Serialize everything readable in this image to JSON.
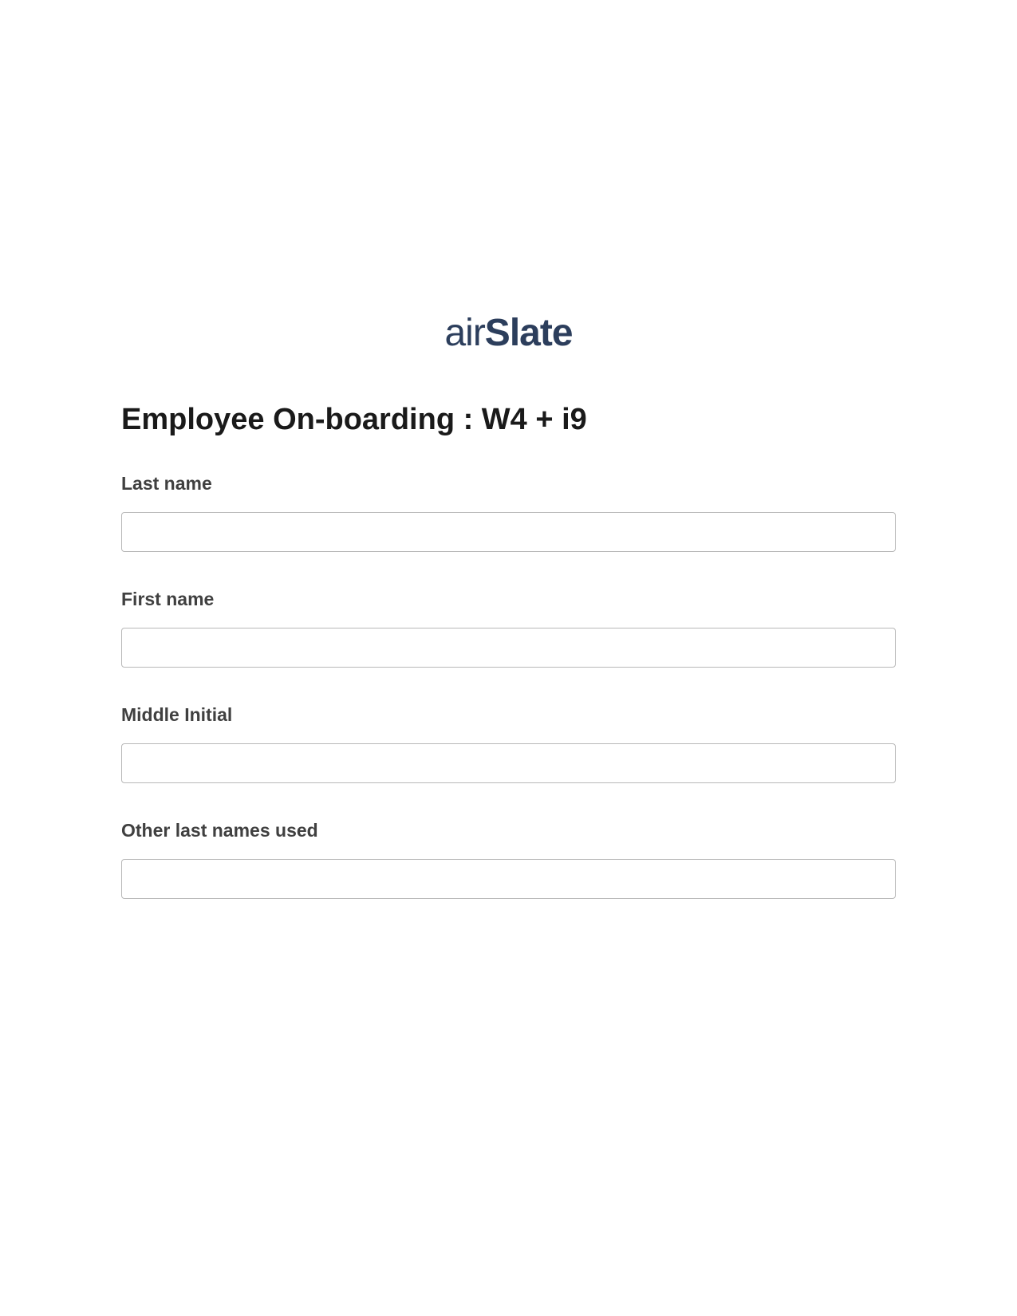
{
  "logo": {
    "prefix": "air",
    "suffix": "Slate"
  },
  "form": {
    "title": "Employee On-boarding : W4 + i9",
    "fields": [
      {
        "label": "Last name",
        "value": ""
      },
      {
        "label": "First name",
        "value": ""
      },
      {
        "label": "Middle Initial",
        "value": ""
      },
      {
        "label": "Other last names used",
        "value": ""
      }
    ]
  }
}
